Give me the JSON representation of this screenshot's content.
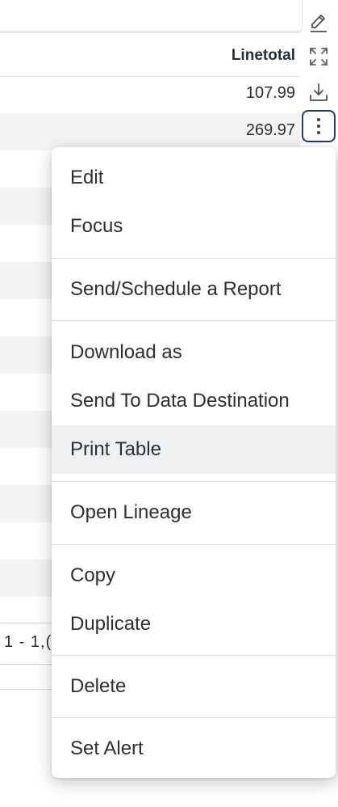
{
  "table": {
    "column_header": "Linetotal",
    "rows": [
      {
        "linetotal": "107.99"
      },
      {
        "linetotal": "269.97"
      }
    ],
    "pager_text": "1 - 1,("
  },
  "toolbar": {
    "icons": [
      "pencil-icon",
      "expand-icon",
      "download-icon",
      "more-vertical-icon"
    ]
  },
  "menu": {
    "items": [
      {
        "label": "Edit"
      },
      {
        "label": "Focus"
      },
      {
        "label": "Send/Schedule a Report"
      },
      {
        "label": "Download as"
      },
      {
        "label": "Send To Data Destination"
      },
      {
        "label": "Print Table"
      },
      {
        "label": "Open Lineage"
      },
      {
        "label": "Copy"
      },
      {
        "label": "Duplicate"
      },
      {
        "label": "Delete"
      },
      {
        "label": "Set Alert"
      }
    ],
    "hovered_item": "Print Table"
  },
  "colors": {
    "accent_border": "#1f3b6a",
    "stripe": "#f3f3f4",
    "hover": "#eef0f2",
    "text": "#2b2f36"
  }
}
